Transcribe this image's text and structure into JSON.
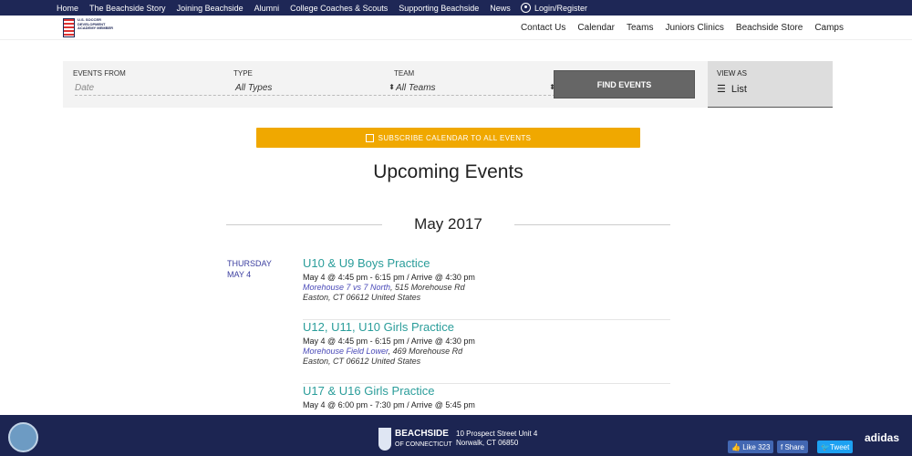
{
  "top_nav": {
    "items": [
      "Home",
      "The Beachside Story",
      "Joining Beachside",
      "Alumni",
      "College Coaches & Scouts",
      "Supporting Beachside",
      "News"
    ],
    "login": "Login/Register"
  },
  "logo": {
    "text": "U.S. SOCCER DEVELOPMENT ACADEMY MEMBER"
  },
  "sub_nav": {
    "items": [
      "Contact Us",
      "Calendar",
      "Teams",
      "Juniors Clinics",
      "Beachside Store",
      "Camps"
    ]
  },
  "filters": {
    "events_from_label": "EVENTS FROM",
    "date_placeholder": "Date",
    "type_label": "TYPE",
    "type_value": "All Types",
    "team_label": "TEAM",
    "team_value": "All Teams",
    "find_button": "FIND EVENTS",
    "view_as_label": "VIEW AS",
    "view_as_value": "List"
  },
  "subscribe_button": "SUBSCRIBE CALENDAR TO ALL EVENTS",
  "page_title": "Upcoming Events",
  "month": "May 2017",
  "day": {
    "weekday": "THURSDAY",
    "date": "MAY 4"
  },
  "events": [
    {
      "title": "U10 & U9 Boys Practice",
      "time": "May 4 @ 4:45 pm - 6:15 pm / Arrive @ 4:30 pm",
      "venue": "Morehouse 7 vs 7 North",
      "address": ", 515 Morehouse Rd",
      "city": "Easton, CT 06612 United States"
    },
    {
      "title": "U12, U11, U10 Girls Practice",
      "time": "May 4 @ 4:45 pm - 6:15 pm / Arrive @ 4:30 pm",
      "venue": "Morehouse Field Lower",
      "address": ", 469 Morehouse Rd",
      "city": "Easton, CT 06612 United States"
    },
    {
      "title": "U17 & U16 Girls Practice",
      "time": "May 4 @ 6:00 pm - 7:30 pm / Arrive @ 5:45 pm"
    }
  ],
  "footer": {
    "brand": "BEACHSIDE",
    "brand_sub": "OF CONNECTICUT",
    "address1": "10 Prospect Street Unit 4",
    "address2": "Norwalk, CT 06850",
    "like": "Like 323",
    "share": "Share",
    "tweet": "Tweet",
    "sponsor": "adidas"
  },
  "colors": {
    "nav": "#1e2756",
    "accent": "#f0a800",
    "event_title": "#2a9d9a",
    "date": "#3c3fa0"
  }
}
